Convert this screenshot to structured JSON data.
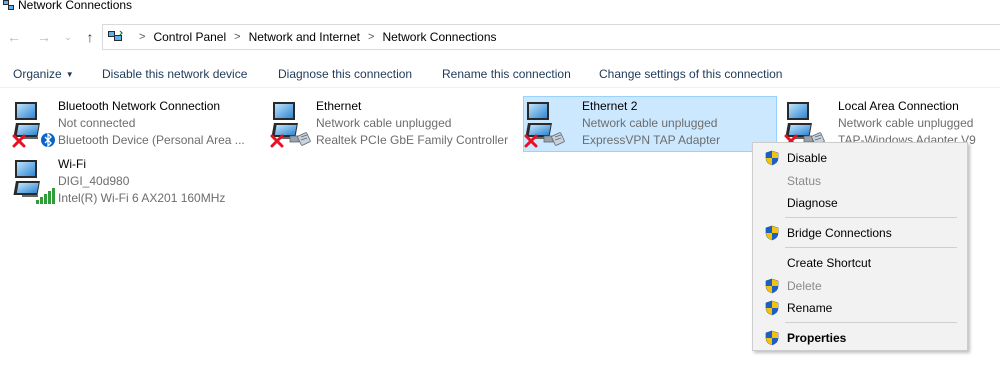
{
  "window": {
    "title": "Network Connections"
  },
  "nav": {
    "back_glyph": "←",
    "forward_glyph": "→",
    "recent_glyph": "⌄",
    "up_glyph": "↑",
    "separator_glyph": ">",
    "breadcrumb": [
      "Control Panel",
      "Network and Internet",
      "Network Connections"
    ]
  },
  "toolbar": {
    "organize_label": "Organize",
    "disable_label": "Disable this network device",
    "diagnose_label": "Diagnose this connection",
    "rename_label": "Rename this connection",
    "change_label": "Change settings of this connection"
  },
  "connections": [
    {
      "name": "Bluetooth Network Connection",
      "status": "Not connected",
      "device": "Bluetooth Device (Personal Area ...",
      "icon": "bluetooth-adapter-icon",
      "state": "disconnected"
    },
    {
      "name": "Ethernet",
      "status": "Network cable unplugged",
      "device": "Realtek PCIe GbE Family Controller",
      "icon": "ethernet-adapter-icon",
      "state": "unplugged"
    },
    {
      "name": "Ethernet 2",
      "status": "Network cable unplugged",
      "device": "ExpressVPN TAP Adapter",
      "icon": "ethernet-adapter-icon",
      "state": "unplugged",
      "selected": true
    },
    {
      "name": "Local Area Connection",
      "status": "Network cable unplugged",
      "device": "TAP-Windows Adapter V9",
      "icon": "ethernet-adapter-icon",
      "state": "unplugged"
    },
    {
      "name": "Wi-Fi",
      "status": "DIGI_40d980",
      "device": "Intel(R) Wi-Fi 6 AX201 160MHz",
      "icon": "wifi-adapter-icon",
      "state": "connected"
    }
  ],
  "context_menu": {
    "items": [
      {
        "label": "Disable",
        "shield": true,
        "enabled": true
      },
      {
        "label": "Status",
        "shield": false,
        "enabled": false
      },
      {
        "label": "Diagnose",
        "shield": false,
        "enabled": true
      },
      {
        "label": "Bridge Connections",
        "shield": true,
        "enabled": true
      },
      {
        "label": "Create Shortcut",
        "shield": false,
        "enabled": true
      },
      {
        "label": "Delete",
        "shield": true,
        "enabled": false
      },
      {
        "label": "Rename",
        "shield": true,
        "enabled": true
      },
      {
        "label": "Properties",
        "shield": true,
        "enabled": true,
        "default": true
      }
    ]
  },
  "colors": {
    "command_text": "#1e395b",
    "selection_bg": "#cce8ff",
    "selection_border": "#99d1ff",
    "secondary_text": "#6d6d6d",
    "menu_bg": "#f2f2f2",
    "error_red": "#e81123",
    "bluetooth_blue": "#0a64c8"
  }
}
